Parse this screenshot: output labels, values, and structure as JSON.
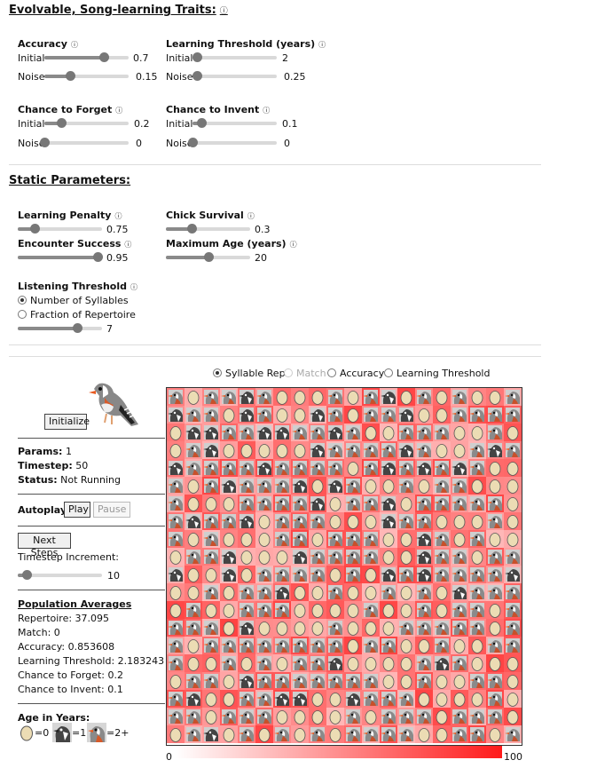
{
  "evolvable": {
    "title": "Evolvable, Song-learning Traits:",
    "info": "ⓘ",
    "accuracy": {
      "label": "Accuracy",
      "initial_label": "Initial",
      "initial_value": "0.7",
      "initial_frac": 0.7,
      "noise_label": "Noise",
      "noise_value": "0.15",
      "noise_frac": 0.3
    },
    "learning_threshold": {
      "label": "Learning Threshold (years)",
      "initial_label": "Initial",
      "initial_value": "2",
      "initial_frac": 0.05,
      "noise_label": "Noise",
      "noise_value": "0.25",
      "noise_frac": 0.05
    },
    "chance_to_forget": {
      "label": "Chance to Forget",
      "initial_label": "Initial",
      "initial_value": "0.2",
      "initial_frac": 0.2,
      "noise_label": "Noise",
      "noise_value": "0",
      "noise_frac": 0.0
    },
    "chance_to_invent": {
      "label": "Chance to Invent",
      "initial_label": "Initial",
      "initial_value": "0.1",
      "initial_frac": 0.1,
      "noise_label": "Noise",
      "noise_value": "0",
      "noise_frac": 0.0
    }
  },
  "static": {
    "title": "Static Parameters:",
    "learning_penalty": {
      "label": "Learning Penalty",
      "value": "0.75",
      "frac": 0.2
    },
    "chick_survival": {
      "label": "Chick Survival",
      "value": "0.3",
      "frac": 0.3
    },
    "encounter_success": {
      "label": "Encounter Success",
      "value": "0.95",
      "frac": 0.95
    },
    "maximum_age": {
      "label": "Maximum Age (years)",
      "value": "20",
      "frac": 0.5
    },
    "listening_threshold": {
      "label": "Listening Threshold",
      "option_syllables": "Number of Syllables",
      "option_fraction": "Fraction of Repertoire",
      "value": "7",
      "frac": 0.7
    }
  },
  "view": {
    "options": [
      "Syllable Rep",
      "Match",
      "Accuracy",
      "Learning Threshold"
    ],
    "selected": "Syllable Rep",
    "disabled": [
      "Match"
    ]
  },
  "sidebar": {
    "initialize_label": "Initialize",
    "params_label": "Params:",
    "params_value": "1",
    "timestep_label": "Timestep:",
    "timestep_value": "50",
    "status_label": "Status:",
    "status_value": "Not Running",
    "autoplay_label": "Autoplay:",
    "play_label": "Play",
    "pause_label": "Pause",
    "next_steps_label": "Next Steps",
    "increment_label": "Timestep Increment:",
    "increment_value": "10",
    "increment_frac": 0.1,
    "averages_title": "Population Averages",
    "repertoire": "Repertoire: 37.095",
    "match": "Match: 0",
    "accuracy": "Accuracy: 0.853608",
    "learning_threshold": "Learning Threshold: 2.183243",
    "chance_to_forget": "Chance to Forget: 0.2",
    "chance_to_invent": "Chance to Invent: 0.1",
    "age_title": "Age in Years:",
    "age_egg": "=0",
    "age_chick": "=1",
    "age_adult": "=2+"
  },
  "scale": {
    "min_label": "0",
    "max_label": "100",
    "color_low": "#ffffff",
    "color_high": "#ff1a1a"
  },
  "colors": {
    "heat": "#e8272a",
    "egg": "#ecdcb4"
  }
}
